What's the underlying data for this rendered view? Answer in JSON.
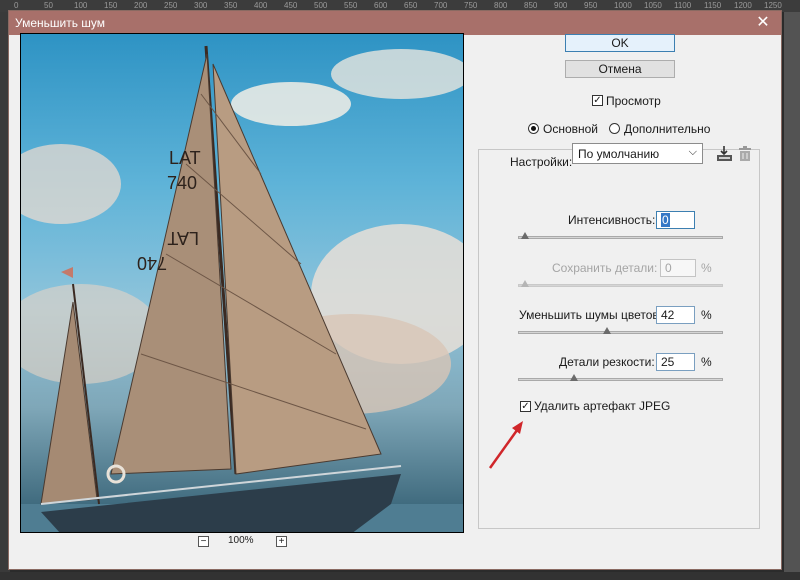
{
  "ruler": {
    "ticks": [
      "0",
      "50",
      "100",
      "150",
      "200",
      "250",
      "300",
      "350",
      "400",
      "450",
      "500",
      "550",
      "600",
      "650",
      "700",
      "750",
      "800",
      "850",
      "900",
      "950",
      "1000",
      "1050",
      "1100",
      "1150",
      "1200",
      "1250"
    ]
  },
  "dialog": {
    "title": "Уменьшить шум",
    "close_icon": "close-icon",
    "zoom": "100%",
    "zoom_out_label": "−",
    "zoom_in_label": "+",
    "ok_label": "OK",
    "cancel_label": "Отмена",
    "preview": {
      "label": "Просмотр",
      "checked": true
    },
    "mode": {
      "basic_label": "Основной",
      "advanced_label": "Дополнительно",
      "selected": "basic"
    },
    "settings": {
      "label": "Настройки:",
      "value": "По умолчанию",
      "save_icon": "save-preset-icon",
      "delete_icon": "trash-icon"
    },
    "sliders": {
      "strength": {
        "label": "Интенсивность:",
        "value": "0",
        "fraction": 0.0,
        "enabled": true
      },
      "preserve_details": {
        "label": "Сохранить детали:",
        "value": "0",
        "unit": "%",
        "fraction": 0.0,
        "enabled": false
      },
      "reduce_color_noise": {
        "label": "Уменьшить шумы цветов:",
        "value": "42",
        "unit": "%",
        "fraction": 0.42,
        "enabled": true
      },
      "sharpen_details": {
        "label": "Детали резкости:",
        "value": "25",
        "unit": "%",
        "fraction": 0.25,
        "enabled": true
      }
    },
    "jpeg_artifact": {
      "label": "Удалить артефакт JPEG",
      "checked": true
    }
  },
  "preview_image": {
    "sail_text_1": "LAT",
    "sail_text_2": "740",
    "sail_text_3": "LAT",
    "sail_text_4": "740"
  },
  "colors": {
    "titlebar": "#a8706a",
    "accent": "#3c7fb1",
    "arrow": "#d0262a"
  }
}
